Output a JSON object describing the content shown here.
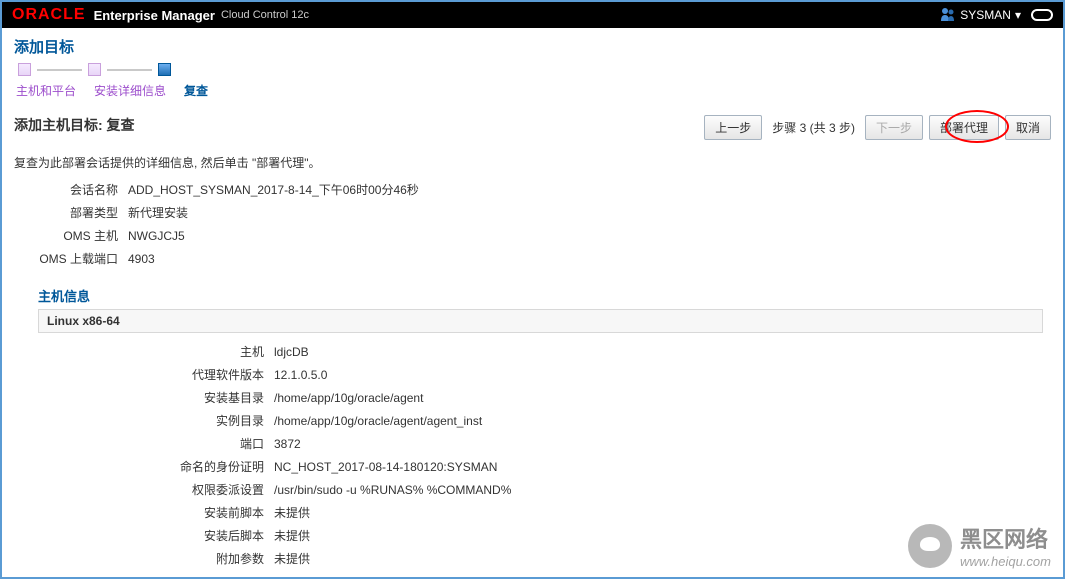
{
  "topbar": {
    "brand": "ORACLE",
    "title": "Enterprise Manager",
    "subtitle": "Cloud Control 12c",
    "user": "SYSMAN"
  },
  "page": {
    "header": "添加目标"
  },
  "wizard": {
    "steps": [
      "主机和平台",
      "安装详细信息",
      "复查"
    ],
    "active_index": 2
  },
  "review": {
    "title": "添加主机目标: 复查",
    "instruction": "复查为此部署会话提供的详细信息, 然后单击 \"部署代理\"。"
  },
  "buttons": {
    "back": "上一步",
    "step_text": "步骤 3 (共 3 步)",
    "next": "下一步",
    "deploy": "部署代理",
    "cancel": "取消"
  },
  "session": {
    "labels": {
      "session_name": "会话名称",
      "deploy_type": "部署类型",
      "oms_host": "OMS 主机",
      "oms_port": "OMS 上载端口"
    },
    "session_name": "ADD_HOST_SYSMAN_2017-8-14_下午06时00分46秒",
    "deploy_type": "新代理安装",
    "oms_host": "NWGJCJ5",
    "oms_port": "4903"
  },
  "host_info": {
    "title": "主机信息",
    "platform": "Linux x86-64",
    "labels": {
      "host": "主机",
      "agent_version": "代理软件版本",
      "install_base": "安装基目录",
      "instance_dir": "实例目录",
      "port": "端口",
      "named_cred": "命名的身份证明",
      "priv_deleg": "权限委派设置",
      "pre_script": "安装前脚本",
      "post_script": "安装后脚本",
      "addl_params": "附加参数"
    },
    "host": "ldjcDB",
    "agent_version": "12.1.0.5.0",
    "install_base": "/home/app/10g/oracle/agent",
    "instance_dir": "/home/app/10g/oracle/agent/agent_inst",
    "port": "3872",
    "named_cred": "NC_HOST_2017-08-14-180120:SYSMAN",
    "priv_deleg": "/usr/bin/sudo -u %RUNAS% %COMMAND%",
    "pre_script": "未提供",
    "post_script": "未提供",
    "addl_params": "未提供"
  },
  "watermark": {
    "title": "黑区网络",
    "url": "www.heiqu.com"
  }
}
